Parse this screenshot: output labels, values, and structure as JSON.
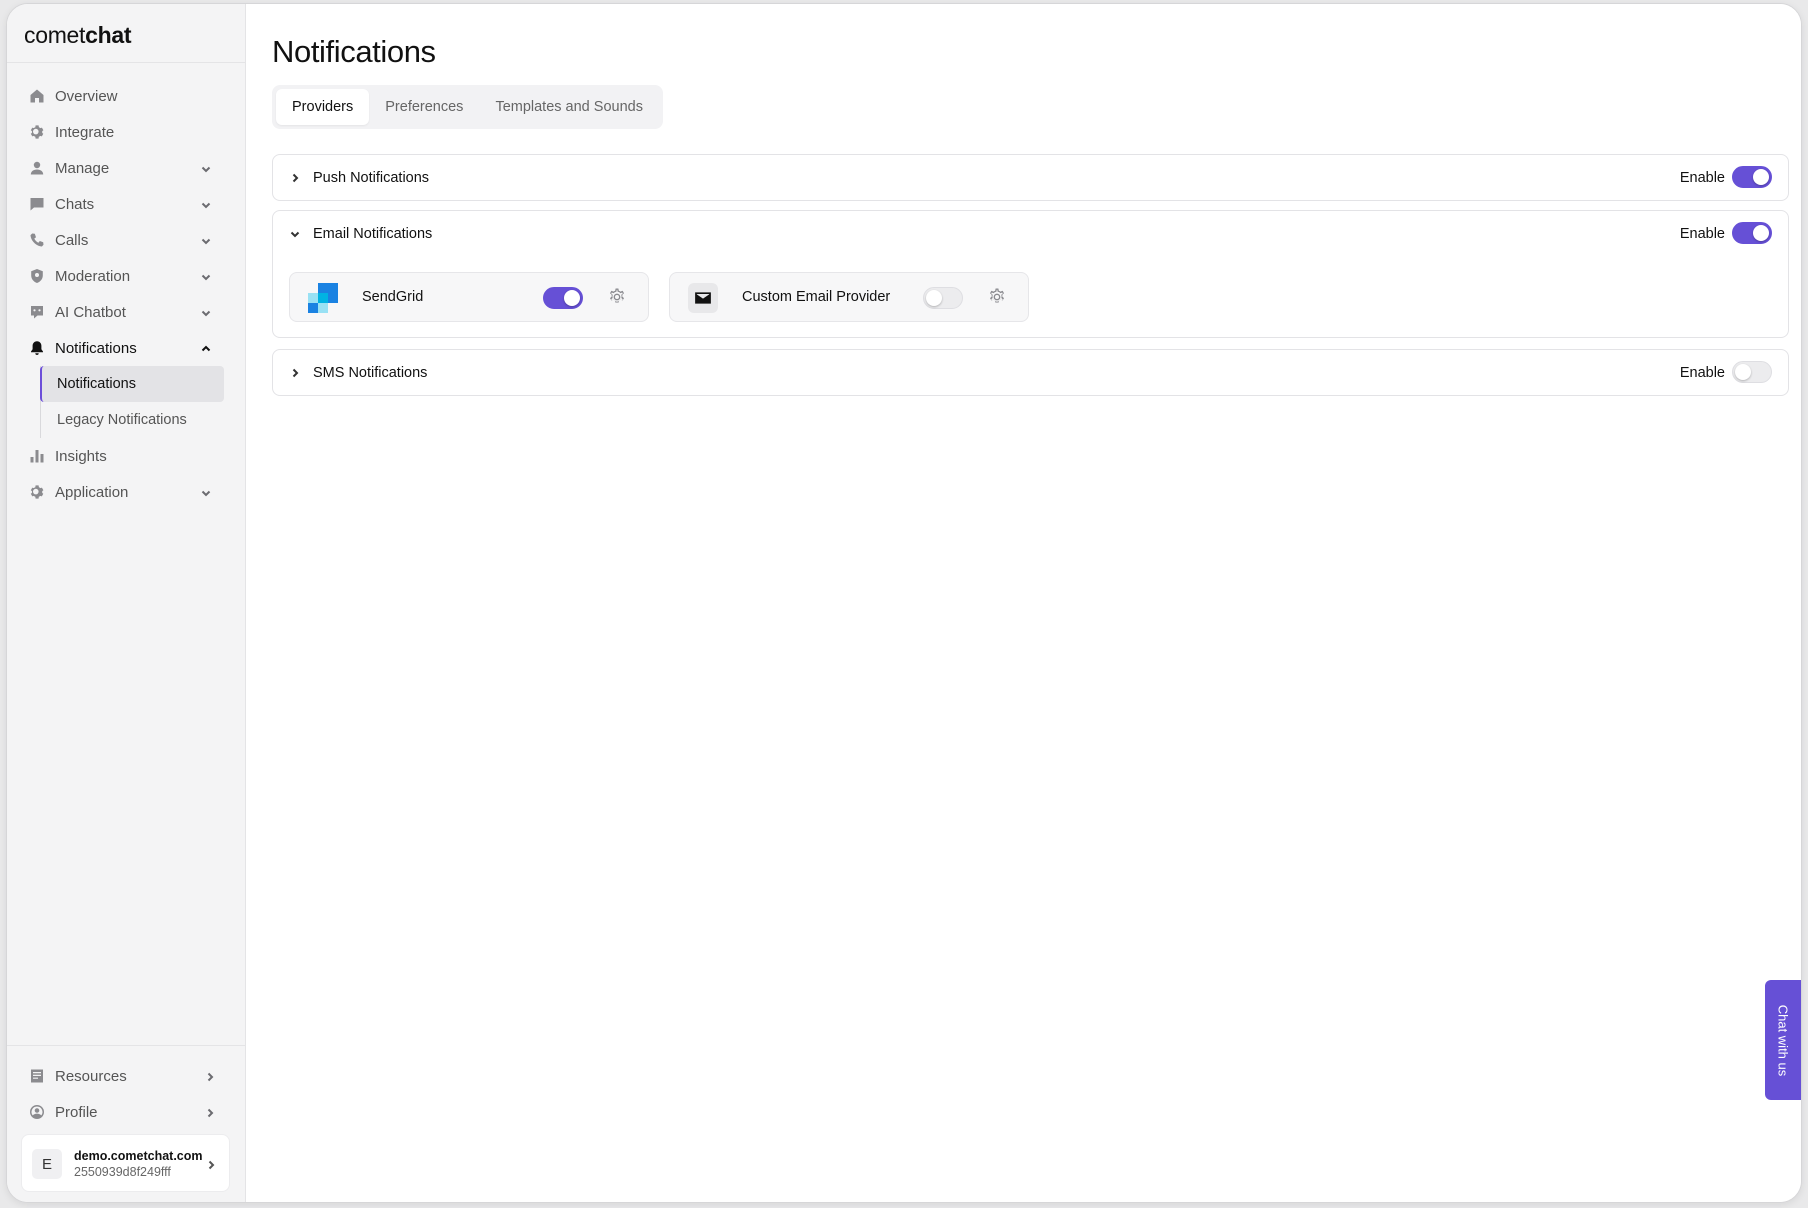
{
  "brand": {
    "prefix": "comet",
    "suffix": "chat",
    "accent": "#6650d6"
  },
  "sidebar": {
    "items": [
      {
        "label": "Overview",
        "icon": "home-icon",
        "chevron": false
      },
      {
        "label": "Integrate",
        "icon": "gear-icon",
        "chevron": false
      },
      {
        "label": "Manage",
        "icon": "person-icon",
        "chevron": true
      },
      {
        "label": "Chats",
        "icon": "chat-icon",
        "chevron": true
      },
      {
        "label": "Calls",
        "icon": "phone-icon",
        "chevron": true
      },
      {
        "label": "Moderation",
        "icon": "shield-icon",
        "chevron": true
      },
      {
        "label": "AI Chatbot",
        "icon": "bot-icon",
        "chevron": true
      },
      {
        "label": "Notifications",
        "icon": "bell-icon",
        "chevron": true,
        "expanded": true,
        "active": true
      },
      {
        "label": "Insights",
        "icon": "bar-chart-icon",
        "chevron": false
      },
      {
        "label": "Application",
        "icon": "gear-icon",
        "chevron": true
      }
    ],
    "subitems": [
      {
        "label": "Notifications",
        "active": true
      },
      {
        "label": "Legacy Notifications",
        "active": false
      }
    ],
    "bottom": [
      {
        "label": "Resources",
        "icon": "book-icon"
      },
      {
        "label": "Profile",
        "icon": "user-circle-icon"
      }
    ],
    "account": {
      "initial": "E",
      "domain": "demo.cometchat.com",
      "app_id": "2550939d8f249fff"
    }
  },
  "main": {
    "title": "Notifications",
    "tabs": [
      {
        "label": "Providers",
        "active": true
      },
      {
        "label": "Preferences",
        "active": false
      },
      {
        "label": "Templates and Sounds",
        "active": false
      }
    ],
    "sections": {
      "push": {
        "title": "Push Notifications",
        "enable_label": "Enable",
        "enabled": true,
        "expanded": false
      },
      "email": {
        "title": "Email Notifications",
        "enable_label": "Enable",
        "enabled": true,
        "expanded": true,
        "providers": [
          {
            "name": "SendGrid",
            "enabled": true,
            "icon": "sendgrid-logo"
          },
          {
            "name": "Custom Email Provider",
            "enabled": false,
            "icon": "mail-icon"
          }
        ]
      },
      "sms": {
        "title": "SMS Notifications",
        "enable_label": "Enable",
        "enabled": false,
        "expanded": false
      }
    }
  },
  "chat_widget": {
    "label": "Chat with us"
  }
}
